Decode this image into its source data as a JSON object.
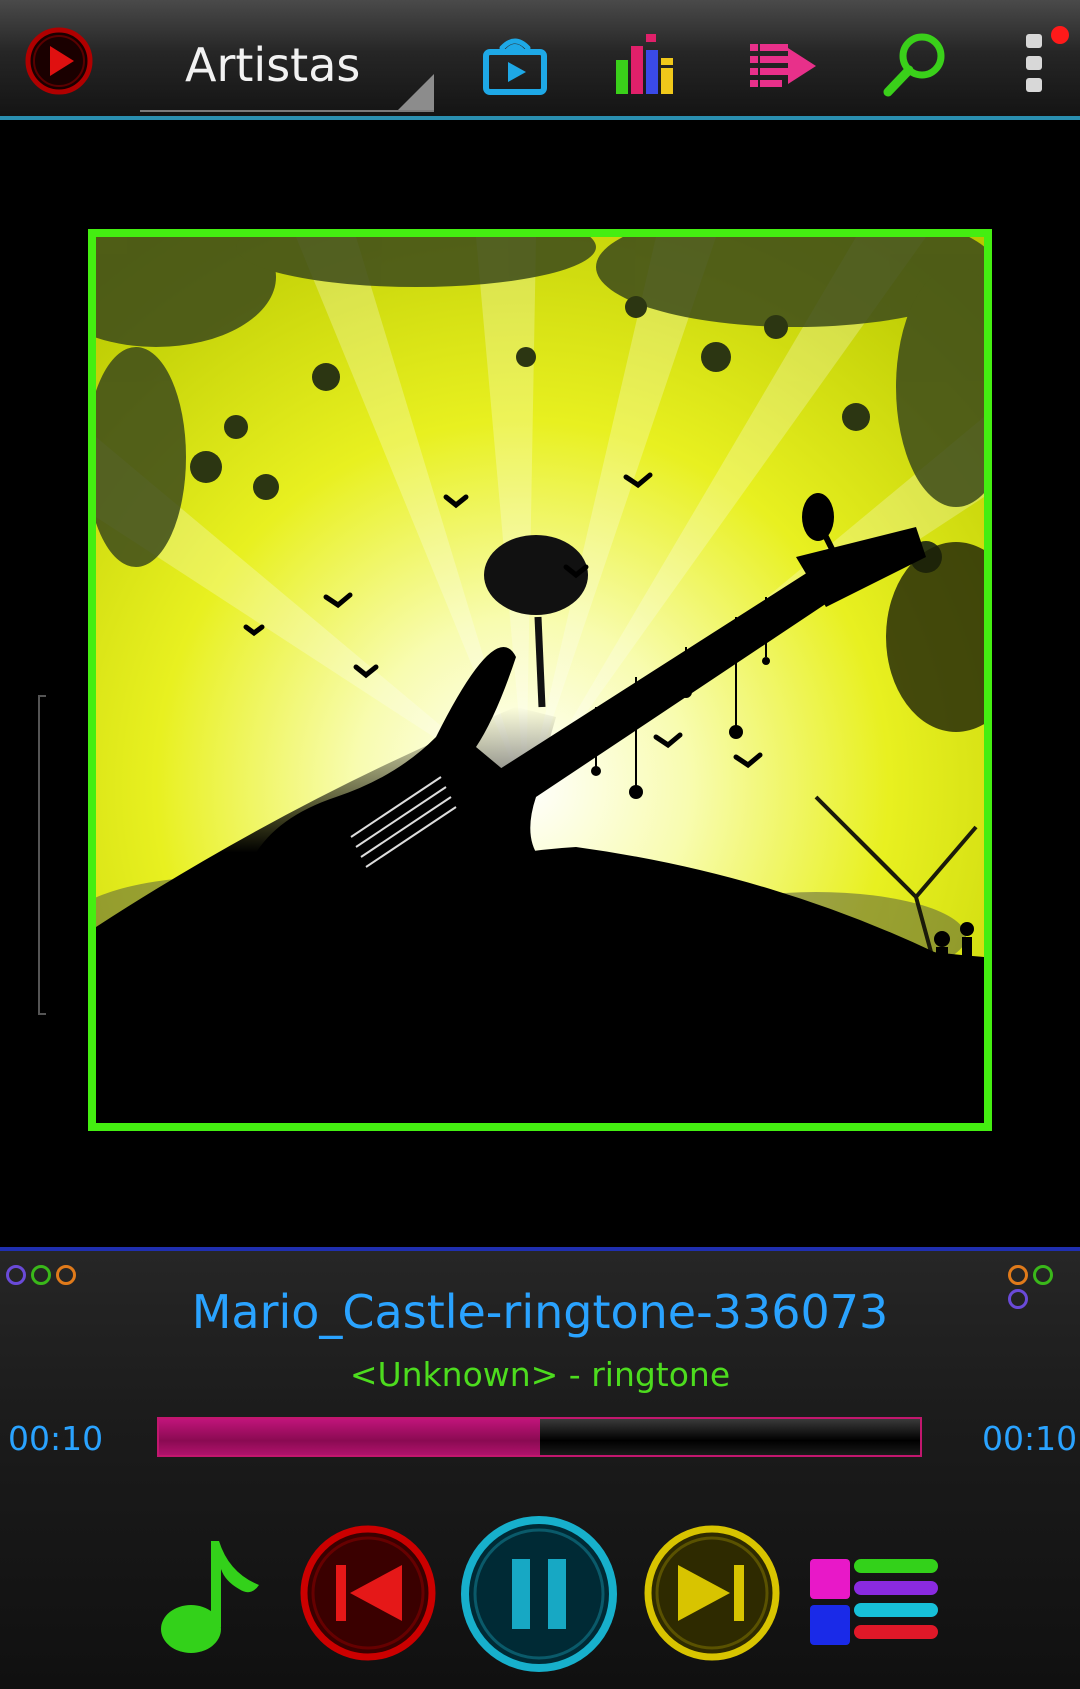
{
  "toolbar": {
    "dropdown_label": "Artistas",
    "icons": [
      "play-logo-icon",
      "cast-icon",
      "equalizer-icon",
      "queue-icon",
      "search-icon",
      "overflow-menu-icon"
    ]
  },
  "player": {
    "track_title": "Mario_Castle-ringtone-336073",
    "track_subtitle": "<Unknown> - ringtone",
    "elapsed": "00:10",
    "duration": "00:10",
    "progress_fraction": 0.5
  },
  "controls": [
    "music-note-icon",
    "previous-icon",
    "pause-icon",
    "next-icon",
    "playlist-icon"
  ],
  "colors": {
    "accent_blue": "#2aa3ff",
    "accent_green": "#4ddc1e",
    "progress_magenta": "#c0147a",
    "frame_green": "#44ee11"
  }
}
